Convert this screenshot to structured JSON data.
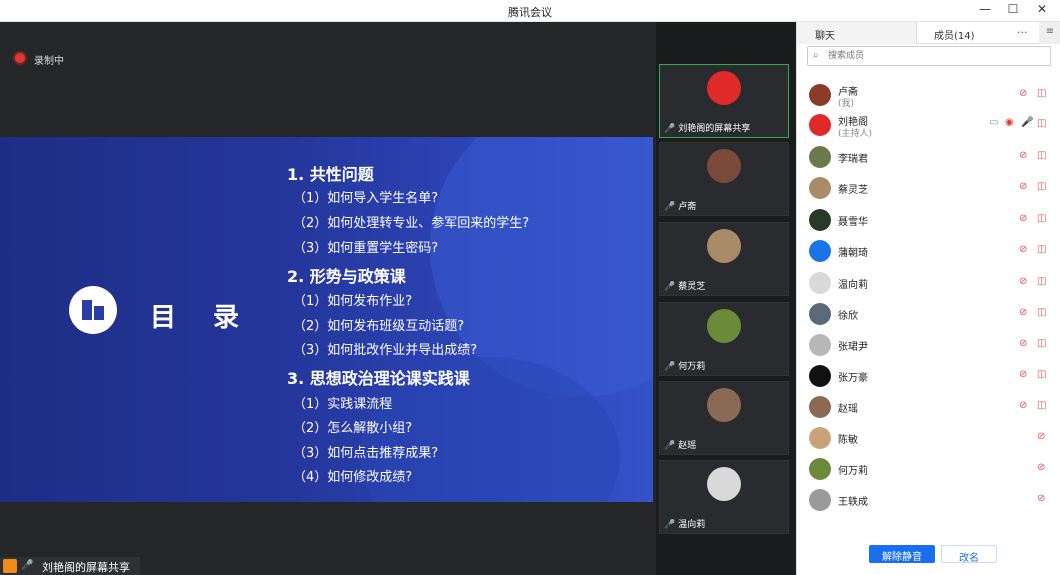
{
  "window": {
    "title": "腾讯会议",
    "minimize": "—",
    "maximize": "☐",
    "close": "✕"
  },
  "stage": {
    "recording_label": "录制中",
    "share_label": "刘艳阁的屏幕共享"
  },
  "slide": {
    "heading": "目 录",
    "sections": [
      {
        "title": "1. 共性问题",
        "items": [
          "（1）如何导入学生名单?",
          "（2）如何处理转专业、参军回来的学生?",
          "（3）如何重置学生密码?"
        ]
      },
      {
        "title": "2. 形势与政策课",
        "items": [
          "（1）如何发布作业?",
          "（2）如何发布班级互动话题?",
          "（3）如何批改作业并导出成绩?"
        ]
      },
      {
        "title": "3. 思想政治理论课实践课",
        "items": [
          "（1）实践课流程",
          "（2）怎么解散小组?",
          "（3）如何点击推荐成果?",
          "（4）如何修改成绩?"
        ]
      }
    ]
  },
  "gallery": {
    "tiles": [
      {
        "name": "刘艳阁的屏幕共享",
        "avatar_color": "#e02a2a",
        "active": true
      },
      {
        "name": "卢斋",
        "avatar_color": "#7a4b3a",
        "active": false
      },
      {
        "name": "蔡灵芝",
        "avatar_color": "#a98b68",
        "active": false
      },
      {
        "name": "何万莉",
        "avatar_color": "#6b8a3a",
        "active": false
      },
      {
        "name": "赵瑶",
        "avatar_color": "#8b6a55",
        "active": false
      },
      {
        "name": "温向莉",
        "avatar_color": "#d9d9d9",
        "active": false
      }
    ]
  },
  "sidebar": {
    "tab_chat": "聊天",
    "tab_members": "成员(14)",
    "more": "···",
    "search_placeholder": "搜索成员",
    "members": [
      {
        "name": "卢斋",
        "role": "(我)",
        "avatar_color": "#8a3b2a"
      },
      {
        "name": "刘艳阁",
        "role": "(主持人)",
        "avatar_color": "#e02a2a"
      },
      {
        "name": "李瑞君",
        "role": "",
        "avatar_color": "#6b7a4a"
      },
      {
        "name": "蔡灵芝",
        "role": "",
        "avatar_color": "#a98b68"
      },
      {
        "name": "聂雪华",
        "role": "",
        "avatar_color": "#2a3a2a"
      },
      {
        "name": "蒲朝琦",
        "role": "",
        "avatar_color": "#1a73e8"
      },
      {
        "name": "温向莉",
        "role": "",
        "avatar_color": "#d9d9d9"
      },
      {
        "name": "徐欣",
        "role": "",
        "avatar_color": "#5a6a7a"
      },
      {
        "name": "张珺尹",
        "role": "",
        "avatar_color": "#b8b8b8"
      },
      {
        "name": "张万豪",
        "role": "",
        "avatar_color": "#111111"
      },
      {
        "name": "赵瑶",
        "role": "",
        "avatar_color": "#8b6a55"
      },
      {
        "name": "陈敏",
        "role": "",
        "avatar_color": "#c9a27a"
      },
      {
        "name": "何万莉",
        "role": "",
        "avatar_color": "#6b8a3a"
      },
      {
        "name": "王轶成",
        "role": "",
        "avatar_color": "#9a9a9a"
      }
    ],
    "unmute_all": "解除静音",
    "rename": "改名"
  }
}
